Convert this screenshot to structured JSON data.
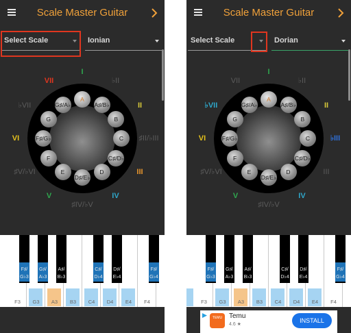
{
  "colors": {
    "accent": "#f0a13a",
    "highlight_box": "#e0361f",
    "key_highlight_blue": "#a6d4f2",
    "key_highlight_orange": "#f5c58a"
  },
  "screens": [
    {
      "app_title": "Scale Master Guitar",
      "menu_icon": "hamburger-menu-icon",
      "next_icon": "chevron-right-icon",
      "scale_type_dropdown": {
        "value": "Select Scale"
      },
      "mode_dropdown": {
        "value": "Ionian"
      },
      "note_labels": [
        "A",
        "A♯/B♭",
        "B",
        "C",
        "C♯/D♭",
        "D",
        "D♯/E♭",
        "E",
        "F",
        "F♯/G♭",
        "G",
        "G♯/A♭"
      ],
      "degree_labels": [
        "I",
        "♭II",
        "II",
        "♯II/♭III",
        "III",
        "IV",
        "♯IV/♭V",
        "V",
        "♯V/♭VI",
        "VI",
        "♭VII",
        "VII"
      ],
      "degree_colors": [
        "#2fa84f",
        "#5c5c5c",
        "#d7c93a",
        "#5c5c5c",
        "#e8962e",
        "#2ea6c9",
        "#5c5c5c",
        "#2fa84f",
        "#5c5c5c",
        "#e6c21c",
        "#5c5c5c",
        "#e0361f"
      ],
      "degree_active": [
        true,
        false,
        true,
        false,
        true,
        true,
        false,
        true,
        false,
        true,
        false,
        true
      ],
      "piano": {
        "white_labels": [
          "F3",
          "G3",
          "A3",
          "B3",
          "C4",
          "D4",
          "E4",
          "F4"
        ],
        "white_colors": [
          "#ffffff",
          "#a6d4f2",
          "#f5c58a",
          "#a6d4f2",
          "#a6d4f2",
          "#a6d4f2",
          "#a6d4f2",
          "#ffffff"
        ],
        "black_keys": [
          {
            "label": "F♯/\nG♭3",
            "color": "#1f73b7"
          },
          {
            "label": "G♯/\nA♭3",
            "color": "#1f73b7"
          },
          {
            "label": "A♯/\nB♭3",
            "color": "#000000"
          },
          {
            "label": "C♯/\nD♭4",
            "color": "#1f73b7"
          },
          {
            "label": "D♯/\nE♭4",
            "color": "#000000"
          },
          {
            "label": "F♯/\nG♭4",
            "color": "#1f73b7"
          }
        ]
      }
    },
    {
      "app_title": "Scale Master Guitar",
      "menu_icon": "hamburger-menu-icon",
      "next_icon": "chevron-right-icon",
      "scale_type_dropdown": {
        "value": "Select Scale"
      },
      "mode_dropdown": {
        "value": "Dorian"
      },
      "note_labels": [
        "A",
        "A♯/B♭",
        "B",
        "C",
        "C♯/D♭",
        "D",
        "D♯/E♭",
        "E",
        "F",
        "F♯/G♭",
        "G",
        "G♯/A♭"
      ],
      "degree_labels": [
        "I",
        "♭II",
        "II",
        "♭III",
        "III",
        "IV",
        "♯IV/♭V",
        "V",
        "♯V/♭VI",
        "VI",
        "♭VII",
        "VII"
      ],
      "degree_colors": [
        "#2fa84f",
        "#5c5c5c",
        "#d7c93a",
        "#2f6fd6",
        "#5c5c5c",
        "#2ea6c9",
        "#5c5c5c",
        "#2fa84f",
        "#5c5c5c",
        "#e6c21c",
        "#2ea6c9",
        "#5c5c5c"
      ],
      "degree_active": [
        true,
        false,
        true,
        true,
        false,
        true,
        false,
        true,
        false,
        true,
        true,
        false
      ],
      "piano": {
        "white_labels": [
          "F3",
          "G3",
          "A3",
          "B3",
          "C4",
          "D4",
          "E4",
          "F4"
        ],
        "white_colors": [
          "#ffffff",
          "#a6d4f2",
          "#f5c58a",
          "#a6d4f2",
          "#a6d4f2",
          "#a6d4f2",
          "#a6d4f2",
          "#ffffff"
        ],
        "black_keys": [
          {
            "label": "F♯/\nG♭3",
            "color": "#1f73b7"
          },
          {
            "label": "G♯/\nA♭3",
            "color": "#000000"
          },
          {
            "label": "A♯/\nB♭3",
            "color": "#000000"
          },
          {
            "label": "C♯/\nD♭4",
            "color": "#000000"
          },
          {
            "label": "D♯/\nE♭4",
            "color": "#000000"
          },
          {
            "label": "F♯/\nG♭4",
            "color": "#1f73b7"
          }
        ]
      },
      "ad": {
        "app_name": "Temu",
        "rating": "4.6 ★",
        "button_label": "INSTALL",
        "logo_text": "TEMU",
        "info_icon": "ad-choices-icon"
      }
    }
  ]
}
